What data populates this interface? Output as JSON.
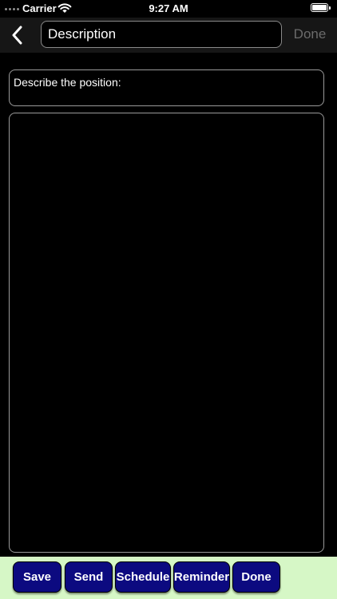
{
  "status_bar": {
    "carrier": "Carrier",
    "time": "9:27 AM",
    "wifi_icon": "wifi-icon",
    "battery_icon": "battery-icon"
  },
  "nav": {
    "back_icon": "chevron-left-icon",
    "title_value": "Description",
    "done_label": "Done"
  },
  "content": {
    "prompt": "Describe the position:",
    "description_value": ""
  },
  "toolbar": {
    "buttons": [
      {
        "label": "Save"
      },
      {
        "label": "Send"
      },
      {
        "label": "Schedule"
      },
      {
        "label": "Reminder"
      },
      {
        "label": "Done"
      }
    ]
  },
  "colors": {
    "background": "#000000",
    "nav_bar": "#161616",
    "toolbar_bg": "#d6f7c6",
    "button_bg": "#0c0a80",
    "disabled_text": "#6b6b6b"
  }
}
